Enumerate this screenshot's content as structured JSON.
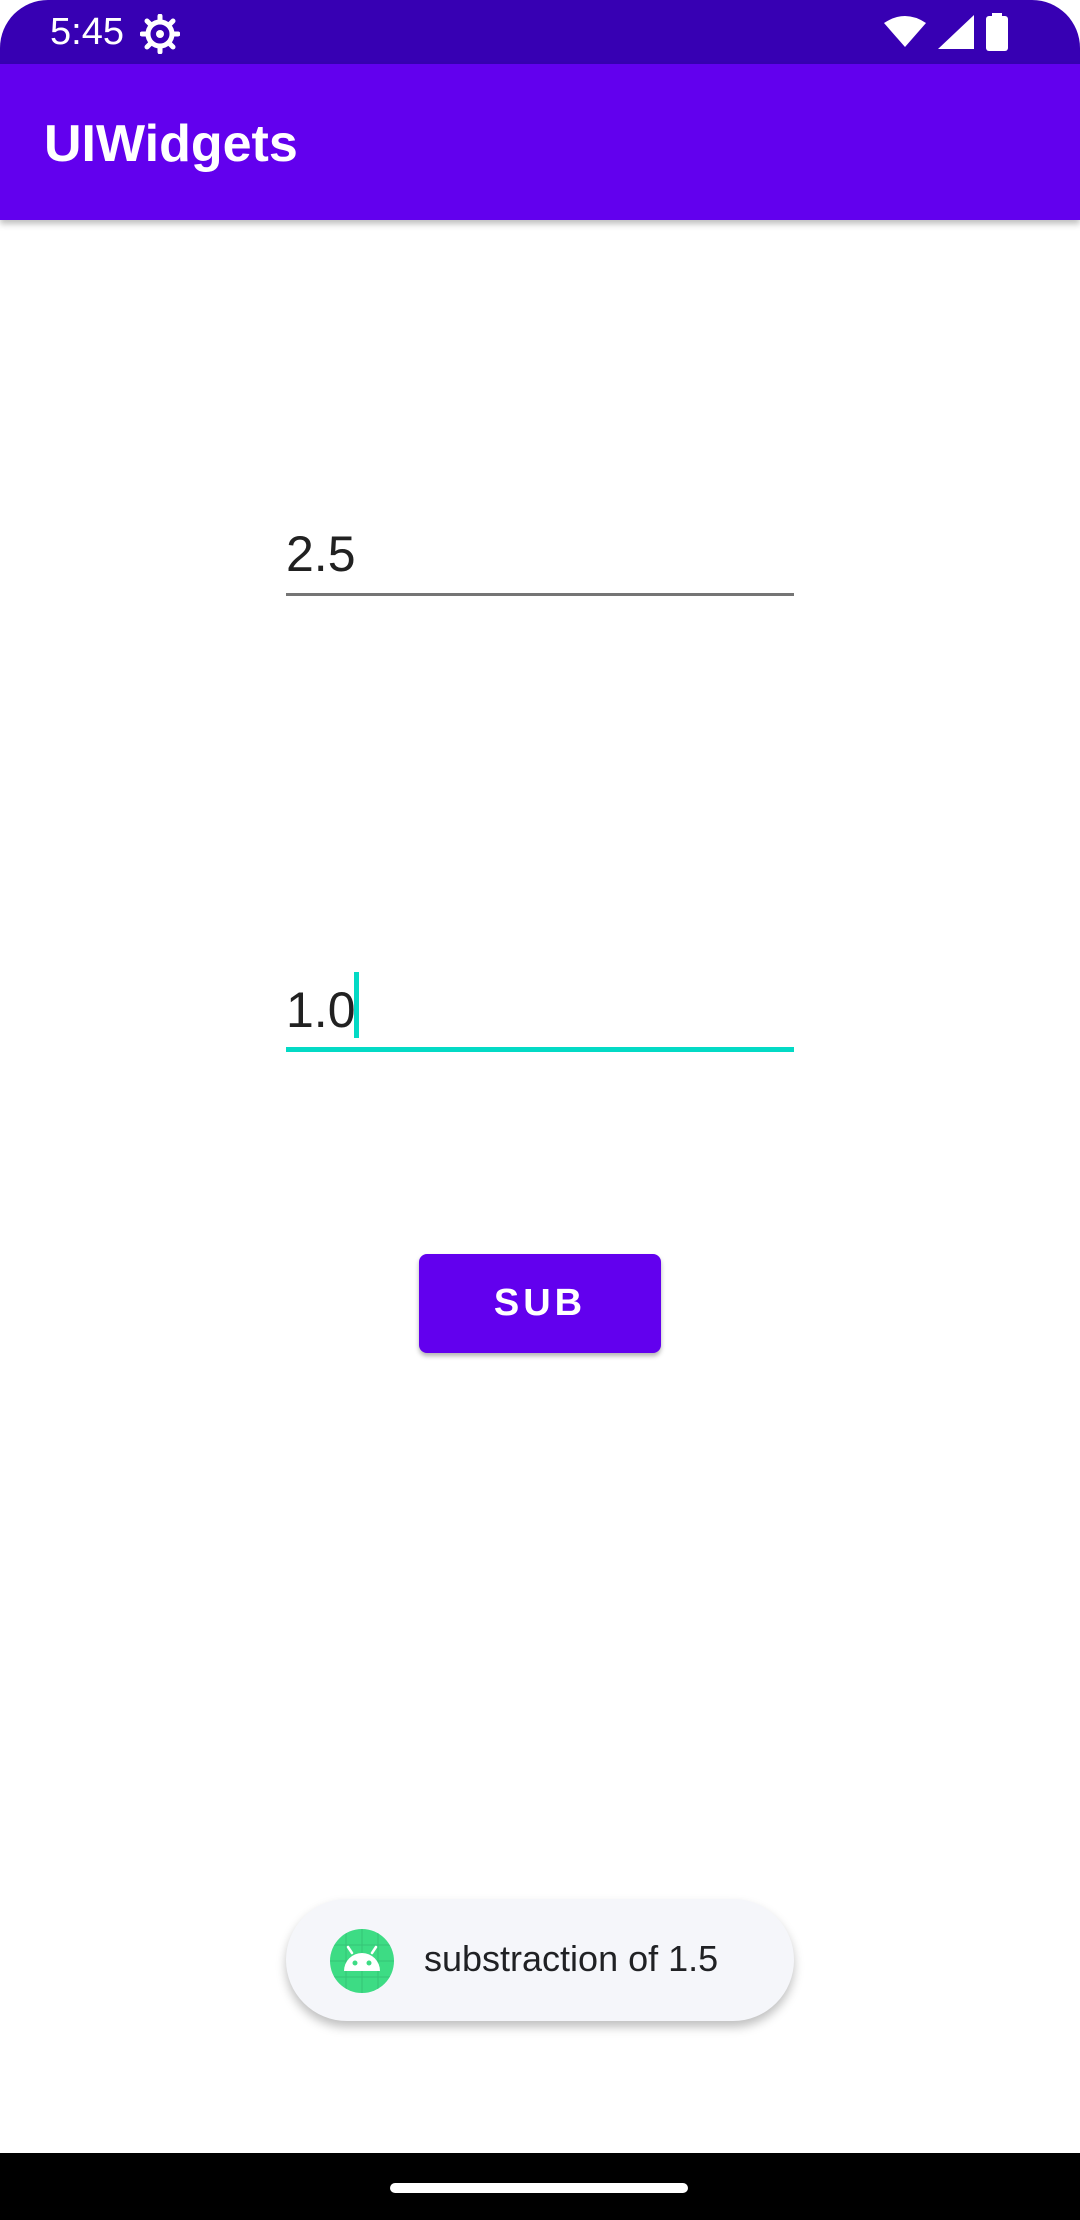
{
  "status_bar": {
    "time": "5:45",
    "icons": [
      "gear-icon",
      "wifi-icon",
      "signal-icon",
      "battery-icon"
    ]
  },
  "app_bar": {
    "title": "UIWidgets"
  },
  "form": {
    "first_value": "2.5",
    "second_value": "1.0",
    "sub_label": "SUB"
  },
  "toast": {
    "message": "substraction of 1.5",
    "icon": "android-icon"
  },
  "colors": {
    "status_bar": "#3700B3",
    "primary": "#6200EE",
    "accent": "#03DAC5",
    "toast_bg": "#F5F6FA",
    "android_green": "#3DDC84"
  }
}
